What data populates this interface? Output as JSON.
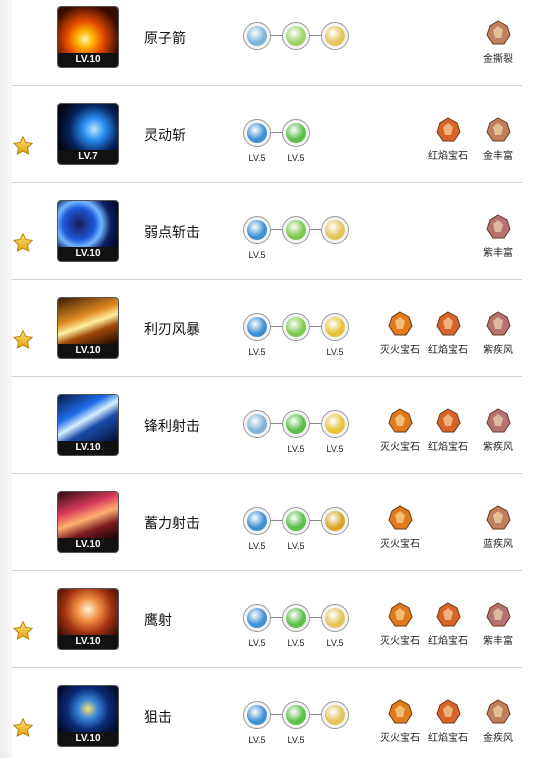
{
  "rows": [
    {
      "name": "原子箭",
      "level": "LV.10",
      "starred": false,
      "art": "atomic",
      "runes": [
        {
          "color": "#7fb3d8",
          "lv": ""
        },
        {
          "color": "#9fd36a",
          "lv": ""
        },
        {
          "color": "#e2c55b",
          "lv": ""
        }
      ],
      "gems": [
        {
          "label": "金撕裂",
          "color": "#c08060"
        }
      ]
    },
    {
      "name": "灵动斩",
      "level": "LV.7",
      "starred": true,
      "art": "blueslash",
      "runes": [
        {
          "color": "#3e8fd6",
          "lv": "LV.5"
        },
        {
          "color": "#5bbf4a",
          "lv": "LV.5"
        }
      ],
      "gems": [
        {
          "label": "红焰宝石",
          "color": "#d8642a"
        },
        {
          "label": "金丰富",
          "color": "#c08060"
        }
      ]
    },
    {
      "name": "弱点斩击",
      "level": "LV.10",
      "starred": true,
      "art": "bluering",
      "runes": [
        {
          "color": "#3e8fd6",
          "lv": "LV.5"
        },
        {
          "color": "#7fc84f",
          "lv": ""
        },
        {
          "color": "#e2c55b",
          "lv": ""
        }
      ],
      "gems": [
        {
          "label": "紫丰富",
          "color": "#b47272"
        }
      ]
    },
    {
      "name": "利刃风暴",
      "level": "LV.10",
      "starred": true,
      "art": "storm",
      "runes": [
        {
          "color": "#3e8fd6",
          "lv": "LV.5"
        },
        {
          "color": "#7fc84f",
          "lv": ""
        },
        {
          "color": "#e8c23c",
          "lv": "LV.5"
        }
      ],
      "gems": [
        {
          "label": "灭火宝石",
          "color": "#e07a1a"
        },
        {
          "label": "红焰宝石",
          "color": "#d8642a"
        },
        {
          "label": "紫疾风",
          "color": "#b47272"
        }
      ]
    },
    {
      "name": "锋利射击",
      "level": "LV.10",
      "starred": false,
      "art": "sharp",
      "runes": [
        {
          "color": "#7fb3d8",
          "lv": ""
        },
        {
          "color": "#5bbf4a",
          "lv": "LV.5"
        },
        {
          "color": "#e8c23c",
          "lv": "LV.5"
        }
      ],
      "gems": [
        {
          "label": "灭火宝石",
          "color": "#e07a1a"
        },
        {
          "label": "红焰宝石",
          "color": "#d8642a"
        },
        {
          "label": "紫疾风",
          "color": "#b47272"
        }
      ]
    },
    {
      "name": "蓄力射击",
      "level": "LV.10",
      "starred": false,
      "art": "charge",
      "runes": [
        {
          "color": "#3e8fd6",
          "lv": "LV.5"
        },
        {
          "color": "#5bbf4a",
          "lv": "LV.5"
        },
        {
          "color": "#d7a52a",
          "lv": ""
        }
      ],
      "gems": [
        {
          "label": "灭火宝石",
          "color": "#e07a1a"
        },
        {
          "label": "蓝疾风",
          "color": "#c08060"
        }
      ]
    },
    {
      "name": "鹰射",
      "level": "LV.10",
      "starred": true,
      "art": "eagle",
      "runes": [
        {
          "color": "#3e8fd6",
          "lv": "LV.5"
        },
        {
          "color": "#5bbf4a",
          "lv": "LV.5"
        },
        {
          "color": "#e2c55b",
          "lv": "LV.5"
        }
      ],
      "gems": [
        {
          "label": "灭火宝石",
          "color": "#e07a1a"
        },
        {
          "label": "红焰宝石",
          "color": "#d8642a"
        },
        {
          "label": "紫丰富",
          "color": "#b47272"
        }
      ]
    },
    {
      "name": "狙击",
      "level": "LV.10",
      "starred": true,
      "art": "snipe",
      "runes": [
        {
          "color": "#3e8fd6",
          "lv": "LV.5"
        },
        {
          "color": "#5bbf4a",
          "lv": "LV.5"
        },
        {
          "color": "#e2c55b",
          "lv": ""
        }
      ],
      "gems": [
        {
          "label": "灭火宝石",
          "color": "#e07a1a"
        },
        {
          "label": "红焰宝石",
          "color": "#d8642a"
        },
        {
          "label": "金疾风",
          "color": "#c08060"
        }
      ]
    }
  ]
}
